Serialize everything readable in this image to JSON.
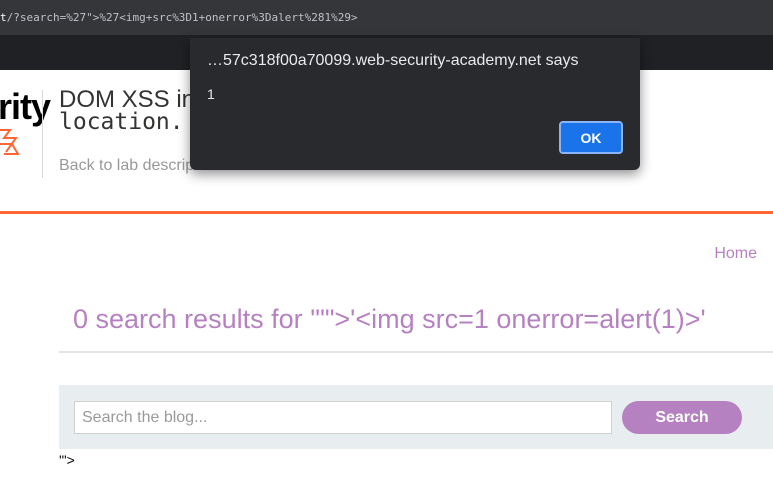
{
  "browser": {
    "url_prefix": "t",
    "url_rest": "/?search=%27\">%27<img+src%3D1+onerror%3Dalert%281%29>"
  },
  "lab_header": {
    "logo_text": "rity",
    "title_line1": "DOM XSS in",
    "title_line2": "location.",
    "back_link": "Back to lab description"
  },
  "blog": {
    "home_link": "Home",
    "results_heading": "0 search results for '\"\">'<img src=1 onerror=alert(1)>'",
    "search": {
      "placeholder": "Search the blog...",
      "value": "",
      "button_label": "Search"
    },
    "injected_text": "'\">"
  },
  "dialog": {
    "title": "…57c318f00a70099.web-security-academy.net says",
    "message": "1",
    "ok_label": "OK"
  },
  "colors": {
    "accent_purple": "#b681c1",
    "orange_rule": "#ff6633",
    "dialog_bg": "#292a2d",
    "ok_button": "#1a73e8"
  }
}
